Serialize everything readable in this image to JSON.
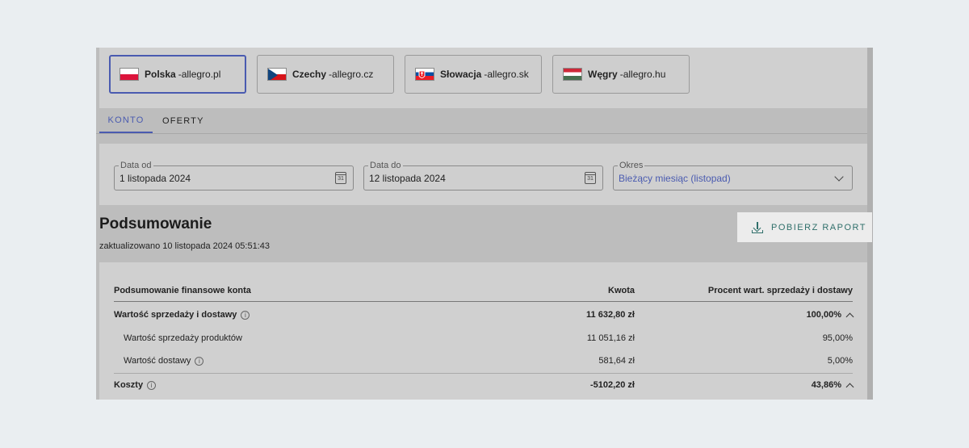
{
  "markets": [
    {
      "country": "Polska",
      "domain": "allegro.pl",
      "active": true,
      "flag": "pl-flag-icon",
      "colors": [
        "#ffffff",
        "#dc143c"
      ]
    },
    {
      "country": "Czechy",
      "domain": "allegro.cz",
      "active": false,
      "flag": "cz-flag-icon",
      "colors": [
        "#ffffff",
        "#d7141a",
        "#11457e"
      ]
    },
    {
      "country": "Słowacja",
      "domain": "allegro.sk",
      "active": false,
      "flag": "sk-flag-icon",
      "colors": [
        "#ffffff",
        "#0b4ea2",
        "#ee1c25"
      ]
    },
    {
      "country": "Węgry",
      "domain": "allegro.hu",
      "active": false,
      "flag": "hu-flag-icon",
      "colors": [
        "#ce2939",
        "#ffffff",
        "#477050"
      ]
    }
  ],
  "domain_separator": " - ",
  "tabs": [
    {
      "label": "KONTO",
      "active": true
    },
    {
      "label": "OFERTY",
      "active": false
    }
  ],
  "filters": {
    "date_from": {
      "label": "Data od",
      "value": "1 listopada 2024"
    },
    "date_to": {
      "label": "Data do",
      "value": "12 listopada 2024"
    },
    "period": {
      "label": "Okres",
      "value": "Bieżący miesiąc (listopad)"
    },
    "calendar_day": "31"
  },
  "summary": {
    "title": "Podsumowanie",
    "updated": "zaktualizowano 10 listopada 2024 05:51:43",
    "report_button": "POBIERZ RAPORT"
  },
  "table": {
    "headers": {
      "name": "Podsumowanie finansowe konta",
      "amount": "Kwota",
      "percent": "Procent wart. sprzedaży i dostawy"
    },
    "rows": [
      {
        "label": "Wartość sprzedaży i dostawy",
        "amount": "11 632,80 zł",
        "percent": "100,00%",
        "bold": true,
        "info": true,
        "expandable": true
      },
      {
        "label": "Wartość sprzedaży produktów",
        "amount": "11 051,16 zł",
        "percent": "95,00%",
        "bold": false,
        "info": false,
        "expandable": false
      },
      {
        "label": "Wartość dostawy",
        "amount": "581,64 zł",
        "percent": "5,00%",
        "bold": false,
        "info": true,
        "expandable": false
      },
      {
        "label": "Koszty",
        "amount": "-5102,20 zł",
        "percent": "43,86%",
        "bold": true,
        "info": true,
        "expandable": true
      }
    ]
  },
  "colors": {
    "accent": "#4a5bb0",
    "report": "#2f6f6a"
  }
}
